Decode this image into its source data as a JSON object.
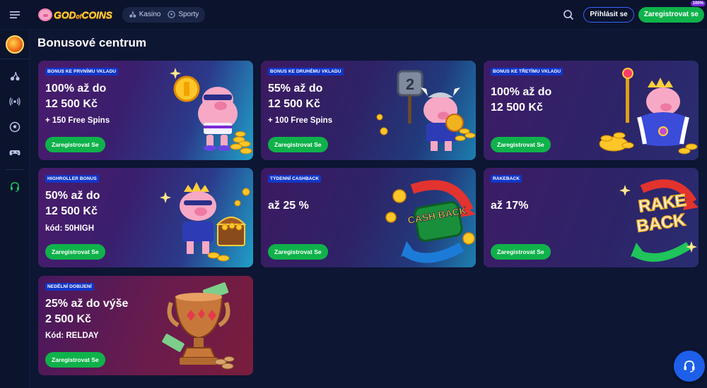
{
  "header": {
    "logo_text_1": "GOD",
    "logo_text_2": "of",
    "logo_text_3": "COINS",
    "switch": [
      {
        "label": "Kasino",
        "icon": "cherries-icon"
      },
      {
        "label": "Sporty",
        "icon": "soccer-ball-icon"
      }
    ],
    "login_label": "Přihlásit se",
    "register_label": "Zaregistrovat se",
    "register_badge": "100%"
  },
  "sidebar": {
    "items": [
      {
        "icon": "cherries-icon"
      },
      {
        "icon": "live-broadcast-icon"
      },
      {
        "icon": "soccer-ball-icon"
      },
      {
        "icon": "gamepad-icon"
      },
      {
        "icon": "support-headset-icon"
      }
    ]
  },
  "page": {
    "title": "Bonusové centrum"
  },
  "cards": [
    {
      "tag": "BONUS KE PRVNÍMU VKLADU",
      "line1": "100% až do",
      "line2": "12 500 Kč",
      "sub": "+ 150 Free Spins",
      "cta": "Zaregistrovat Se",
      "art": "coin-pig-illustration"
    },
    {
      "tag": "BONUS KE DRUHÉMU VKLADU",
      "line1": "55% až do",
      "line2": "12 500 Kč",
      "sub": "+ 100 Free Spins",
      "cta": "Zaregistrovat Se",
      "art": "viking-pig-illustration"
    },
    {
      "tag": "BONUS KE TŘETÍMU VKLADU",
      "line1": "100% až do",
      "line2": "12 500 Kč",
      "sub": "",
      "cta": "Zaregistrovat Se",
      "art": "king-pig-illustration"
    },
    {
      "tag": "HIGHROLLER BONUS",
      "line1": "50% až do",
      "line2": "12 500 Kč",
      "sub": "kód: 50HIGH",
      "cta": "Zaregistrovat Se",
      "art": "treasure-pig-illustration"
    },
    {
      "tag": "TÝDENNÍ CASHBACK",
      "line1": "až 25 %",
      "line2": "",
      "sub": "",
      "cta": "Zaregistrovat Se",
      "art": "cashback-illustration"
    },
    {
      "tag": "RAKEBACK",
      "line1": "až 17%",
      "line2": "",
      "sub": "",
      "cta": "Zaregistrovat Se",
      "art": "rakeback-illustration"
    },
    {
      "tag": "NEDĚLNÍ DOBIJENÍ",
      "line1": "25% až do výše",
      "line2": "2 500 Kč",
      "sub": "Kód: RELDAY",
      "cta": "Zaregistrovat Se",
      "art": "trophy-illustration"
    }
  ],
  "art_text": {
    "cashback": "CASH BACK",
    "rakeback_1": "RAKE",
    "rakeback_2": "BACK",
    "viking_number": "2"
  }
}
